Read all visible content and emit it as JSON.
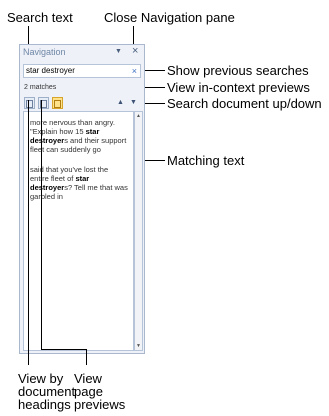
{
  "callouts": {
    "search_text": "Search text",
    "close_nav": "Close Navigation pane",
    "show_previous": "Show previous searches",
    "in_context": "View in-context previews",
    "search_up_down": "Search document up/down",
    "matching_text": "Matching text",
    "view_headings": "View by document headings",
    "view_pages": "View page previews"
  },
  "pane": {
    "title": "Navigation",
    "menu_icon": "dropdown-arrow-icon",
    "close_glyph": "×",
    "search_value": "star destroyer",
    "clear_glyph": "×",
    "matches": "2 matches",
    "up_arrow": "▲",
    "down_arrow": "▼"
  },
  "results": [
    {
      "before": "more nervous than angry. \"Explain how 15 ",
      "match": "star destroyer",
      "after": "s and their support fleet can suddenly go"
    },
    {
      "before": "said that you've lost the entire fleet of ",
      "match": "star destroyer",
      "after": "s? Tell me that was garbled in"
    }
  ],
  "scroll": {
    "up": "▲",
    "down": "▼"
  },
  "colors": {
    "active_tab": "#ffe28a",
    "pane_bg": "#eef2f8",
    "border": "#a9b8cc"
  }
}
